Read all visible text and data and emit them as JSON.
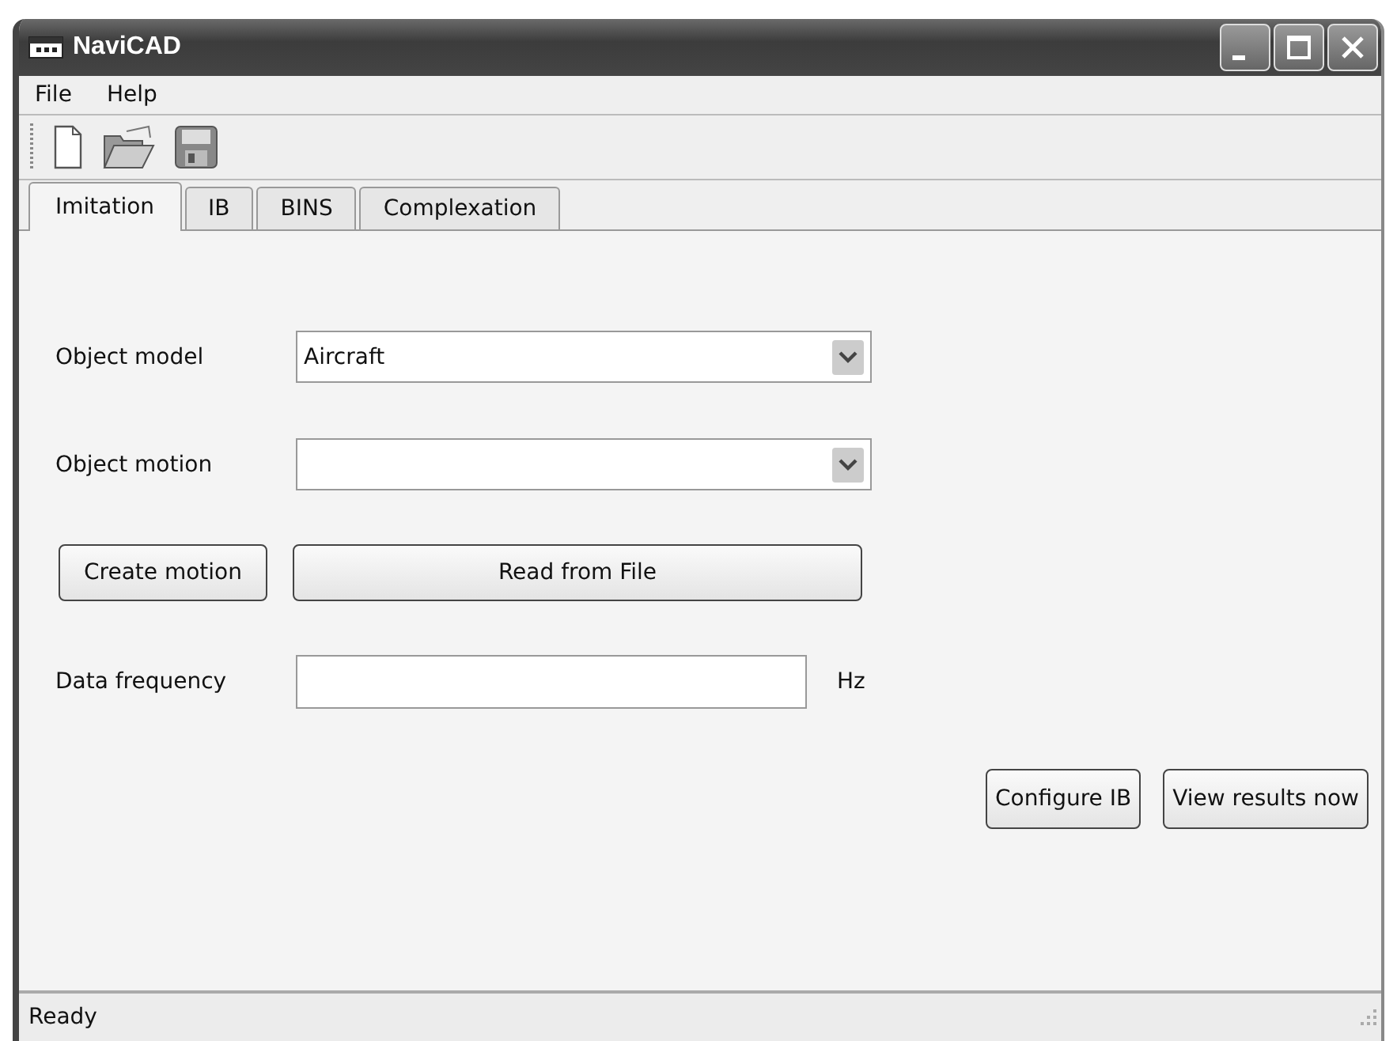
{
  "window": {
    "title": "NaviCAD"
  },
  "menu": [
    "File",
    "Help"
  ],
  "tabs": [
    {
      "label": "Imitation",
      "selected": true
    },
    {
      "label": "IB",
      "selected": false
    },
    {
      "label": "BINS",
      "selected": false
    },
    {
      "label": "Complexation",
      "selected": false
    }
  ],
  "form": {
    "object_model": {
      "label": "Object model",
      "value": "Aircraft"
    },
    "object_motion": {
      "label": "Object motion"
    },
    "create_button": "Create motion",
    "read_button": "Read from File",
    "frequency": {
      "label": "Data frequency",
      "unit": "Hz"
    }
  },
  "actions": [
    "Configure IB",
    "View results now"
  ],
  "status_bar": "Ready"
}
